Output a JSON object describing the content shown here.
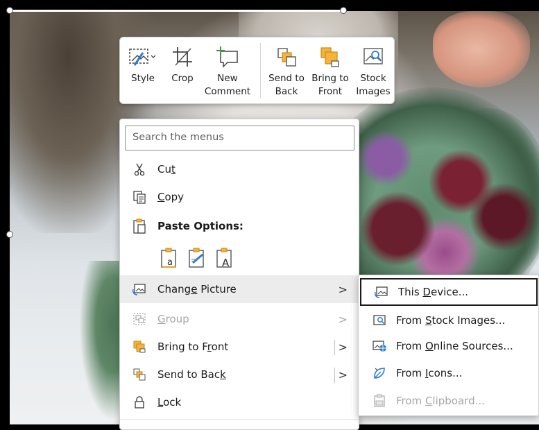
{
  "mini_toolbar": {
    "buttons": [
      {
        "line1": "Style",
        "line2": "",
        "icon": "style-icon"
      },
      {
        "line1": "Crop",
        "line2": "",
        "icon": "crop-icon"
      },
      {
        "line1": "New",
        "line2": "Comment",
        "icon": "new-comment-icon"
      },
      {
        "line1": "Send to",
        "line2": "Back",
        "icon": "send-to-back-icon"
      },
      {
        "line1": "Bring to",
        "line2": "Front",
        "icon": "bring-to-front-icon"
      },
      {
        "line1": "Stock",
        "line2": "Images",
        "icon": "stock-images-icon"
      }
    ]
  },
  "context_menu": {
    "search_placeholder": "Search the menus",
    "items": {
      "cut": {
        "pre": "Cu",
        "key": "t",
        "post": ""
      },
      "copy": {
        "pre": "",
        "key": "C",
        "post": "opy"
      },
      "paste_options": {
        "label": "Paste Options:"
      },
      "change_picture": {
        "pre": "Chang",
        "key": "e",
        "post": " Picture"
      },
      "group": {
        "pre": "",
        "key": "G",
        "post": "roup"
      },
      "bring_to_front": {
        "pre": "Bring to F",
        "key": "r",
        "post": "ont"
      },
      "send_to_back": {
        "pre": "Send to Bac",
        "key": "k",
        "post": ""
      },
      "lock": {
        "pre": "",
        "key": "L",
        "post": "ock"
      }
    },
    "chevron": ">"
  },
  "submenu": {
    "items": {
      "this_device": {
        "pre": "This ",
        "key": "D",
        "post": "evice..."
      },
      "stock_images": {
        "pre": "From ",
        "key": "S",
        "post": "tock Images..."
      },
      "online_sources": {
        "pre": "From ",
        "key": "O",
        "post": "nline Sources..."
      },
      "icons": {
        "pre": "From ",
        "key": "I",
        "post": "cons..."
      },
      "clipboard": {
        "pre": "From ",
        "key": "C",
        "post": "lipboard..."
      }
    }
  },
  "colors": {
    "accent_orange": "#f5b33b",
    "icon_gray": "#444444",
    "icon_blue": "#2b7cd3",
    "disabled_text": "#a6a6a6"
  }
}
